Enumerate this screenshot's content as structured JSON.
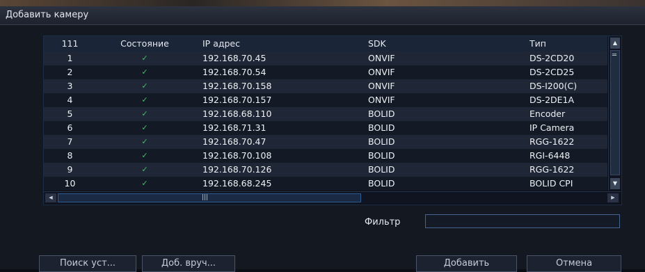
{
  "window": {
    "title": "Добавить камеру"
  },
  "table": {
    "headers": {
      "num": "111",
      "state": "Состояние",
      "ip": "IP адрес",
      "sdk": "SDK",
      "type": "Тип"
    },
    "rows": [
      {
        "num": "1",
        "state": "✓",
        "ip": "192.168.70.45",
        "sdk": "ONVIF",
        "type": "DS-2CD20"
      },
      {
        "num": "2",
        "state": "✓",
        "ip": "192.168.70.54",
        "sdk": "ONVIF",
        "type": "DS-2CD25"
      },
      {
        "num": "3",
        "state": "✓",
        "ip": "192.168.70.158",
        "sdk": "ONVIF",
        "type": "DS-I200(C)"
      },
      {
        "num": "4",
        "state": "✓",
        "ip": "192.168.70.157",
        "sdk": "ONVIF",
        "type": "DS-2DE1A"
      },
      {
        "num": "5",
        "state": "✓",
        "ip": "192.168.68.110",
        "sdk": "BOLID",
        "type": "Encoder"
      },
      {
        "num": "6",
        "state": "✓",
        "ip": "192.168.71.31",
        "sdk": "BOLID",
        "type": "IP Camera"
      },
      {
        "num": "7",
        "state": "✓",
        "ip": "192.168.70.47",
        "sdk": "BOLID",
        "type": "RGG-1622"
      },
      {
        "num": "8",
        "state": "✓",
        "ip": "192.168.70.108",
        "sdk": "BOLID",
        "type": "RGI-6448"
      },
      {
        "num": "9",
        "state": "✓",
        "ip": "192.168.70.126",
        "sdk": "BOLID",
        "type": "RGG-1622"
      },
      {
        "num": "10",
        "state": "✓",
        "ip": "192.168.68.245",
        "sdk": "BOLID",
        "type": "BOLID CPI"
      }
    ]
  },
  "scroll": {
    "up": "▲",
    "down": "▼",
    "left": "◀",
    "right": "▶",
    "vgrip": "═",
    "hgrip": "|||"
  },
  "filter": {
    "label": "Фильтр",
    "value": ""
  },
  "buttons": {
    "search": "Поиск уст...",
    "manual": "Доб. вруч...",
    "add": "Добавить",
    "cancel": "Отмена"
  },
  "colors": {
    "accent": "#46648f",
    "status_ok": "#3fc25a",
    "background": "#141821"
  }
}
